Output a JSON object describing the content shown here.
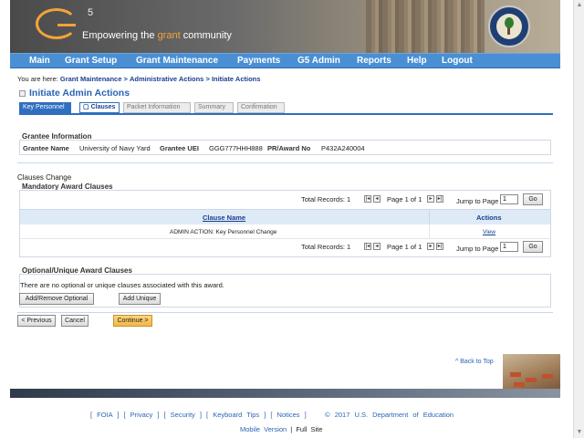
{
  "header": {
    "logo_mark": "G",
    "logo_sup": "5",
    "tagline_pre": "Empowering the",
    "tagline_grant": "grant",
    "tagline_post": "community"
  },
  "nav": {
    "items": [
      "Main",
      "Grant Setup",
      "Grant Maintenance",
      "Payments",
      "G5 Admin",
      "Reports",
      "Help",
      "Logout"
    ]
  },
  "breadcrumb": {
    "prefix": "You are here:",
    "crumbs": [
      "Grant Maintenance",
      "Administrative Actions",
      "Initiate Actions"
    ],
    "sep": ">"
  },
  "page": {
    "title": "Initiate Admin Actions"
  },
  "tabs": [
    "Key Personnel",
    "Clauses",
    "Packet Information",
    "Summary",
    "Confirmation"
  ],
  "grantee": {
    "heading": "Grantee Information",
    "name_label": "Grantee Name",
    "name_value": "University of Navy Yard",
    "uei_label": "Grantee UEI",
    "uei_value": "GGG777HHH888",
    "award_label": "PR/Award No",
    "award_value": "P432A240004"
  },
  "clauses": {
    "section_label": "Clauses Change",
    "mandatory_heading": "Mandatory Award Clauses",
    "total_records_label": "Total Records:",
    "total_records": "1",
    "page_of": "Page 1 of 1",
    "jump_label": "Jump to Page",
    "jump_value": "1",
    "go_label": "Go",
    "col_clause": "Clause Name",
    "col_actions": "Actions",
    "rows": [
      {
        "name": "ADMIN ACTION: Key Personnel Change",
        "action": "View"
      }
    ],
    "optional_heading": "Optional/Unique Award Clauses",
    "optional_empty": "There are no optional or unique clauses associated with this award.",
    "add_remove_label": "Add/Remove Optional",
    "add_unique_label": "Add Unique"
  },
  "actions": {
    "previous": "< Previous",
    "cancel": "Cancel",
    "continue": "Continue >"
  },
  "back_to_top": "^ Back to Top",
  "footer": {
    "links": "[ FOIA ] [ Privacy ] [ Security ] [ Keyboard Tips ] [ Notices ]",
    "copyright": "© 2017 U.S. Department of Education",
    "mobile": "Mobile Version",
    "sep": "|",
    "full": "Full Site"
  },
  "colors": {
    "nav_blue": "#4a8fd4",
    "title_blue": "#2a64b4",
    "accent_orange": "#f2a33a"
  }
}
